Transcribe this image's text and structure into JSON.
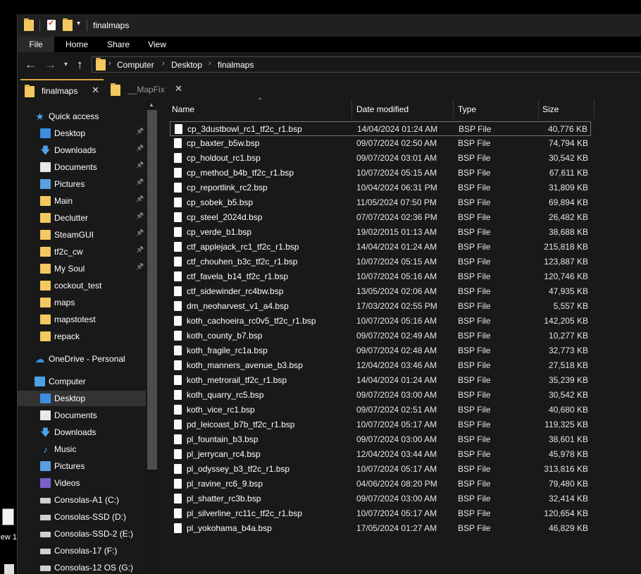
{
  "window": {
    "title": "finalmaps"
  },
  "desktop": {
    "file_label": "ew 1"
  },
  "ribbon": {
    "tabs": [
      "File",
      "Home",
      "Share",
      "View"
    ]
  },
  "address": {
    "crumbs": [
      "Computer",
      "Desktop",
      "finalmaps"
    ]
  },
  "folder_tabs": [
    {
      "label": "finalmaps",
      "active": true
    },
    {
      "label": "__MapFix",
      "active": false
    }
  ],
  "sidebar": {
    "items": [
      {
        "label": "Quick access",
        "icon": "star-icon",
        "level": 1,
        "pinned": false
      },
      {
        "label": "Desktop",
        "icon": "desktop-icon",
        "level": 2,
        "pinned": true
      },
      {
        "label": "Downloads",
        "icon": "downloads-icon",
        "level": 2,
        "pinned": true
      },
      {
        "label": "Documents",
        "icon": "documents-icon",
        "level": 2,
        "pinned": true
      },
      {
        "label": "Pictures",
        "icon": "pictures-icon",
        "level": 2,
        "pinned": true
      },
      {
        "label": "Main",
        "icon": "folder-icon",
        "level": 2,
        "pinned": true
      },
      {
        "label": "Declutter",
        "icon": "folder-icon",
        "level": 2,
        "pinned": true
      },
      {
        "label": "SteamGUI",
        "icon": "folder-icon",
        "level": 2,
        "pinned": true
      },
      {
        "label": "tf2c_cw",
        "icon": "folder-icon",
        "level": 2,
        "pinned": true
      },
      {
        "label": "My Soul",
        "icon": "folder-icon",
        "level": 2,
        "pinned": true
      },
      {
        "label": "cockout_test",
        "icon": "folder-icon",
        "level": 2,
        "pinned": false
      },
      {
        "label": "maps",
        "icon": "folder-icon",
        "level": 2,
        "pinned": false
      },
      {
        "label": "mapstotest",
        "icon": "folder-icon",
        "level": 2,
        "pinned": false
      },
      {
        "label": "repack",
        "icon": "folder-icon",
        "level": 2,
        "pinned": false
      },
      {
        "label": "OneDrive - Personal",
        "icon": "cloud-icon",
        "level": 1,
        "pinned": false,
        "gap": true
      },
      {
        "label": "Computer",
        "icon": "computer-icon",
        "level": 1,
        "pinned": false,
        "gap": true
      },
      {
        "label": "Desktop",
        "icon": "desktop-icon",
        "level": 2,
        "pinned": false,
        "selected": true
      },
      {
        "label": "Documents",
        "icon": "documents-icon",
        "level": 2,
        "pinned": false
      },
      {
        "label": "Downloads",
        "icon": "downloads-icon",
        "level": 2,
        "pinned": false
      },
      {
        "label": "Music",
        "icon": "music-icon",
        "level": 2,
        "pinned": false
      },
      {
        "label": "Pictures",
        "icon": "pictures-icon",
        "level": 2,
        "pinned": false
      },
      {
        "label": "Videos",
        "icon": "videos-icon",
        "level": 2,
        "pinned": false
      },
      {
        "label": "Consolas-A1 (C:)",
        "icon": "drive-icon",
        "level": 2,
        "pinned": false
      },
      {
        "label": "Consolas-SSD (D:)",
        "icon": "drive-icon",
        "level": 2,
        "pinned": false
      },
      {
        "label": "Consolas-SSD-2 (E:)",
        "icon": "drive-icon",
        "level": 2,
        "pinned": false
      },
      {
        "label": "Consolas-17 (F:)",
        "icon": "drive-icon",
        "level": 2,
        "pinned": false
      },
      {
        "label": "Consolas-12 OS (G:)",
        "icon": "drive-icon",
        "level": 2,
        "pinned": false
      }
    ]
  },
  "columns": {
    "name": "Name",
    "date": "Date modified",
    "type": "Type",
    "size": "Size"
  },
  "files": [
    {
      "name": "cp_3dustbowl_rc1_tf2c_r1.bsp",
      "date": "14/04/2024 01:24 AM",
      "type": "BSP File",
      "size": "40,776 KB"
    },
    {
      "name": "cp_baxter_b5w.bsp",
      "date": "09/07/2024 02:50 AM",
      "type": "BSP File",
      "size": "74,794 KB"
    },
    {
      "name": "cp_holdout_rc1.bsp",
      "date": "09/07/2024 03:01 AM",
      "type": "BSP File",
      "size": "30,542 KB"
    },
    {
      "name": "cp_method_b4b_tf2c_r1.bsp",
      "date": "10/07/2024 05:15 AM",
      "type": "BSP File",
      "size": "67,611 KB"
    },
    {
      "name": "cp_reportlink_rc2.bsp",
      "date": "10/04/2024 06:31 PM",
      "type": "BSP File",
      "size": "31,809 KB"
    },
    {
      "name": "cp_sobek_b5.bsp",
      "date": "11/05/2024 07:50 PM",
      "type": "BSP File",
      "size": "69,894 KB"
    },
    {
      "name": "cp_steel_2024d.bsp",
      "date": "07/07/2024 02:36 PM",
      "type": "BSP File",
      "size": "26,482 KB"
    },
    {
      "name": "cp_verde_b1.bsp",
      "date": "19/02/2015 01:13 AM",
      "type": "BSP File",
      "size": "38,688 KB"
    },
    {
      "name": "ctf_applejack_rc1_tf2c_r1.bsp",
      "date": "14/04/2024 01:24 AM",
      "type": "BSP File",
      "size": "215,818 KB"
    },
    {
      "name": "ctf_chouhen_b3c_tf2c_r1.bsp",
      "date": "10/07/2024 05:15 AM",
      "type": "BSP File",
      "size": "123,887 KB"
    },
    {
      "name": "ctf_favela_b14_tf2c_r1.bsp",
      "date": "10/07/2024 05:16 AM",
      "type": "BSP File",
      "size": "120,746 KB"
    },
    {
      "name": "ctf_sidewinder_rc4bw.bsp",
      "date": "13/05/2024 02:06 AM",
      "type": "BSP File",
      "size": "47,935 KB"
    },
    {
      "name": "dm_neoharvest_v1_a4.bsp",
      "date": "17/03/2024 02:55 PM",
      "type": "BSP File",
      "size": "5,557 KB"
    },
    {
      "name": "koth_cachoeira_rc0v5_tf2c_r1.bsp",
      "date": "10/07/2024 05:16 AM",
      "type": "BSP File",
      "size": "142,205 KB"
    },
    {
      "name": "koth_county_b7.bsp",
      "date": "09/07/2024 02:49 AM",
      "type": "BSP File",
      "size": "10,277 KB"
    },
    {
      "name": "koth_fragile_rc1a.bsp",
      "date": "09/07/2024 02:48 AM",
      "type": "BSP File",
      "size": "32,773 KB"
    },
    {
      "name": "koth_manners_avenue_b3.bsp",
      "date": "12/04/2024 03:46 AM",
      "type": "BSP File",
      "size": "27,518 KB"
    },
    {
      "name": "koth_metrorail_tf2c_r1.bsp",
      "date": "14/04/2024 01:24 AM",
      "type": "BSP File",
      "size": "35,239 KB"
    },
    {
      "name": "koth_quarry_rc5.bsp",
      "date": "09/07/2024 03:00 AM",
      "type": "BSP File",
      "size": "30,542 KB"
    },
    {
      "name": "koth_vice_rc1.bsp",
      "date": "09/07/2024 02:51 AM",
      "type": "BSP File",
      "size": "40,680 KB"
    },
    {
      "name": "pd_leicoast_b7b_tf2c_r1.bsp",
      "date": "10/07/2024 05:17 AM",
      "type": "BSP File",
      "size": "119,325 KB"
    },
    {
      "name": "pl_fountain_b3.bsp",
      "date": "09/07/2024 03:00 AM",
      "type": "BSP File",
      "size": "38,601 KB"
    },
    {
      "name": "pl_jerrycan_rc4.bsp",
      "date": "12/04/2024 03:44 AM",
      "type": "BSP File",
      "size": "45,978 KB"
    },
    {
      "name": "pl_odyssey_b3_tf2c_r1.bsp",
      "date": "10/07/2024 05:17 AM",
      "type": "BSP File",
      "size": "313,816 KB"
    },
    {
      "name": "pl_ravine_rc6_9.bsp",
      "date": "04/06/2024 08:20 PM",
      "type": "BSP File",
      "size": "79,480 KB"
    },
    {
      "name": "pl_shatter_rc3b.bsp",
      "date": "09/07/2024 03:00 AM",
      "type": "BSP File",
      "size": "32,414 KB"
    },
    {
      "name": "pl_silverline_rc11c_tf2c_r1.bsp",
      "date": "10/07/2024 05:17 AM",
      "type": "BSP File",
      "size": "120,654 KB"
    },
    {
      "name": "pl_yokohama_b4a.bsp",
      "date": "17/05/2024 01:27 AM",
      "type": "BSP File",
      "size": "46,829 KB"
    }
  ]
}
